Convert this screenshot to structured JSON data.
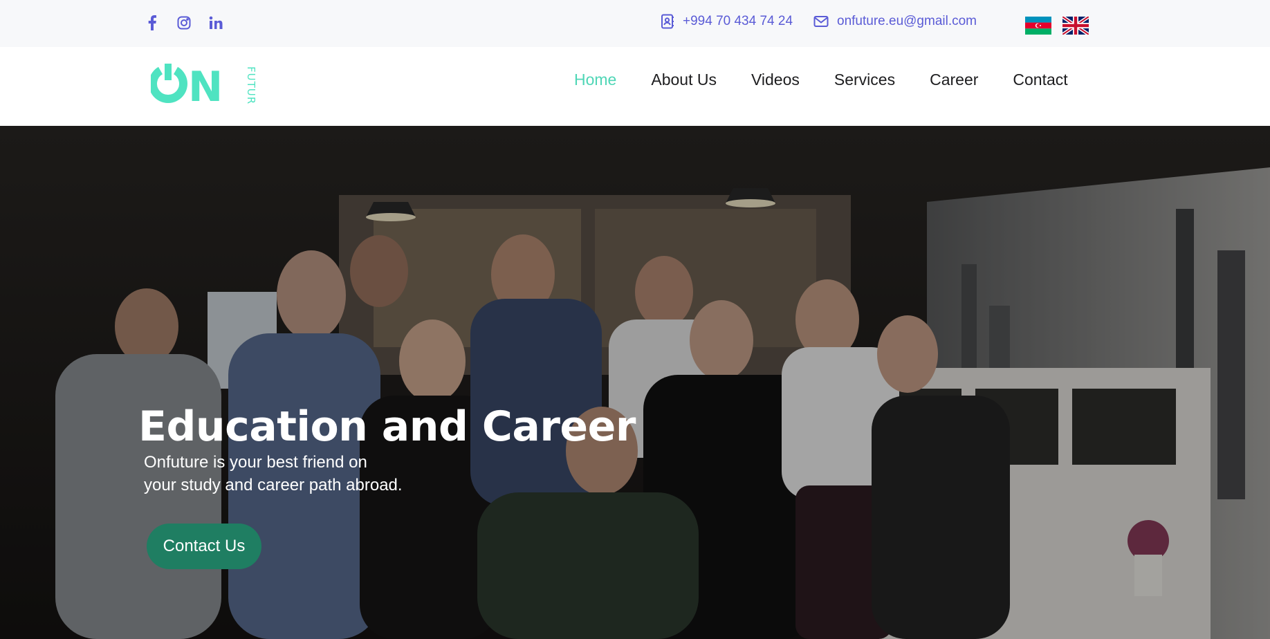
{
  "topbar": {
    "social": [
      {
        "icon": "facebook-icon"
      },
      {
        "icon": "instagram-icon"
      },
      {
        "icon": "linkedin-icon"
      }
    ],
    "phone": "+994 70 434 74 24",
    "email": "onfuture.eu@gmail.com",
    "languages": [
      {
        "icon": "azerbaijan-flag-icon"
      },
      {
        "icon": "uk-flag-icon"
      }
    ],
    "accent_color": "#5a5bd6"
  },
  "header": {
    "logo_text": "ON",
    "logo_side_text": "FUTURE",
    "logo_color": "#4fe3c1",
    "nav": [
      {
        "label": "Home",
        "active": true
      },
      {
        "label": "About Us",
        "active": false
      },
      {
        "label": "Videos",
        "active": false
      },
      {
        "label": "Services",
        "active": false
      },
      {
        "label": "Career",
        "active": false
      },
      {
        "label": "Contact",
        "active": false
      }
    ],
    "active_color": "#4fd6b6"
  },
  "hero": {
    "title": "Education and Career",
    "subtitle_line1": "Onfuture is your best friend on",
    "subtitle_line2": "your study and career path abroad.",
    "cta_label": "Contact Us",
    "cta_color": "#1f7e62"
  }
}
